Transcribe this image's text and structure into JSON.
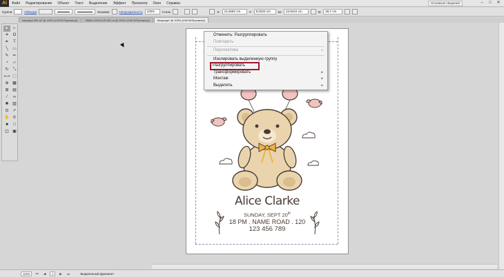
{
  "app": {
    "logo": "Ai",
    "menus": [
      "Файл",
      "Редактирование",
      "Объект",
      "Текст",
      "Выделение",
      "Эффект",
      "Просмотр",
      "Окно",
      "Справка"
    ],
    "workspace": "Основные сведения"
  },
  "control_bar": {
    "selection_label": "Группа",
    "fill_label": "Обводка",
    "stroke_style": "Базовая",
    "opacity_label": "Непрозрачность",
    "opacity_value": "100%",
    "style_label": "Стиль",
    "x_value": "10,4692 cm",
    "y_value": "9,0323 cm",
    "w_value": "24,9424 cm",
    "h_value": "29,7 cm"
  },
  "tabs": [
    {
      "label": "матрица 999.ai* @ 100% (CMYK/Просмотр)",
      "active": false
    },
    {
      "label": "85654-OWGLZR-502.ai @ 100% (CMYK/Просмотр)",
      "active": false
    },
    {
      "label": "Матрица* @ 100% (CMYK/Просмотр)",
      "active": true
    }
  ],
  "tools": [
    {
      "icon": "selection-tool-icon",
      "glyph": "▸",
      "active": true
    },
    {
      "icon": "direct-selection-tool-icon",
      "glyph": "▹"
    },
    {
      "icon": "magic-wand-tool-icon",
      "glyph": "✶"
    },
    {
      "icon": "lasso-tool-icon",
      "glyph": "ʘ"
    },
    {
      "icon": "pen-tool-icon",
      "glyph": "✒"
    },
    {
      "icon": "type-tool-icon",
      "glyph": "T"
    },
    {
      "icon": "line-tool-icon",
      "glyph": "╲"
    },
    {
      "icon": "rectangle-tool-icon",
      "glyph": "▭"
    },
    {
      "icon": "paintbrush-tool-icon",
      "glyph": "✎"
    },
    {
      "icon": "pencil-tool-icon",
      "glyph": "✏"
    },
    {
      "icon": "blob-brush-tool-icon",
      "glyph": "◔"
    },
    {
      "icon": "eraser-tool-icon",
      "glyph": "▱"
    },
    {
      "icon": "rotate-tool-icon",
      "glyph": "↻"
    },
    {
      "icon": "scale-tool-icon",
      "glyph": "⤡"
    },
    {
      "icon": "width-tool-icon",
      "glyph": "⟷"
    },
    {
      "icon": "free-transform-tool-icon",
      "glyph": "⬚"
    },
    {
      "icon": "shape-builder-tool-icon",
      "glyph": "⊕"
    },
    {
      "icon": "perspective-grid-tool-icon",
      "glyph": "▦"
    },
    {
      "icon": "mesh-tool-icon",
      "glyph": "⊞"
    },
    {
      "icon": "gradient-tool-icon",
      "glyph": "▤"
    },
    {
      "icon": "eyedropper-tool-icon",
      "glyph": "⁄"
    },
    {
      "icon": "blend-tool-icon",
      "glyph": "∞"
    },
    {
      "icon": "symbol-sprayer-tool-icon",
      "glyph": "✺"
    },
    {
      "icon": "graph-tool-icon",
      "glyph": "▥"
    },
    {
      "icon": "artboard-tool-icon",
      "glyph": "⊡"
    },
    {
      "icon": "slice-tool-icon",
      "glyph": "⌿"
    },
    {
      "icon": "hand-tool-icon",
      "glyph": "✋"
    },
    {
      "icon": "zoom-tool-icon",
      "glyph": "⚲"
    },
    {
      "icon": "fill-color-icon",
      "glyph": "■"
    },
    {
      "icon": "stroke-color-icon",
      "glyph": "□"
    },
    {
      "icon": "drawing-mode-icon",
      "glyph": "◫"
    },
    {
      "icon": "screen-mode-icon",
      "glyph": "▣"
    }
  ],
  "context_menu": {
    "items": [
      {
        "label": "Отменить: Разгруппировать",
        "disabled": false,
        "submenu": false
      },
      {
        "label": "Повторить",
        "disabled": true,
        "submenu": false
      },
      {
        "separator": true
      },
      {
        "label": "Перспектива",
        "disabled": true,
        "submenu": true
      },
      {
        "separator": true
      },
      {
        "label": "Изолировать выделенную группу",
        "disabled": false,
        "submenu": false
      },
      {
        "label": "Разгруппировать",
        "disabled": false,
        "submenu": false,
        "highlighted": true
      },
      {
        "label": "Трансформировать",
        "disabled": false,
        "submenu": true
      },
      {
        "label": "Монтаж",
        "disabled": false,
        "submenu": true
      },
      {
        "label": "Выделить",
        "disabled": false,
        "submenu": true
      }
    ],
    "highlight_color": "#a0172c"
  },
  "card": {
    "name": "Alice Clarke",
    "date_main": "SUNDAY, SEPT 20",
    "date_suffix": "th",
    "address": "18 PM . NAME ROAD . 120",
    "phone": "123 456 789",
    "text_color": "#4a3b34",
    "bear_color": "#e9d4ad",
    "ribbon_color": "#f1b23b",
    "balloon_color": "#f1c2c0"
  },
  "status": {
    "zoom": "100%",
    "artboard_number": "1",
    "selection_info": "Выделенный фрагмент"
  }
}
